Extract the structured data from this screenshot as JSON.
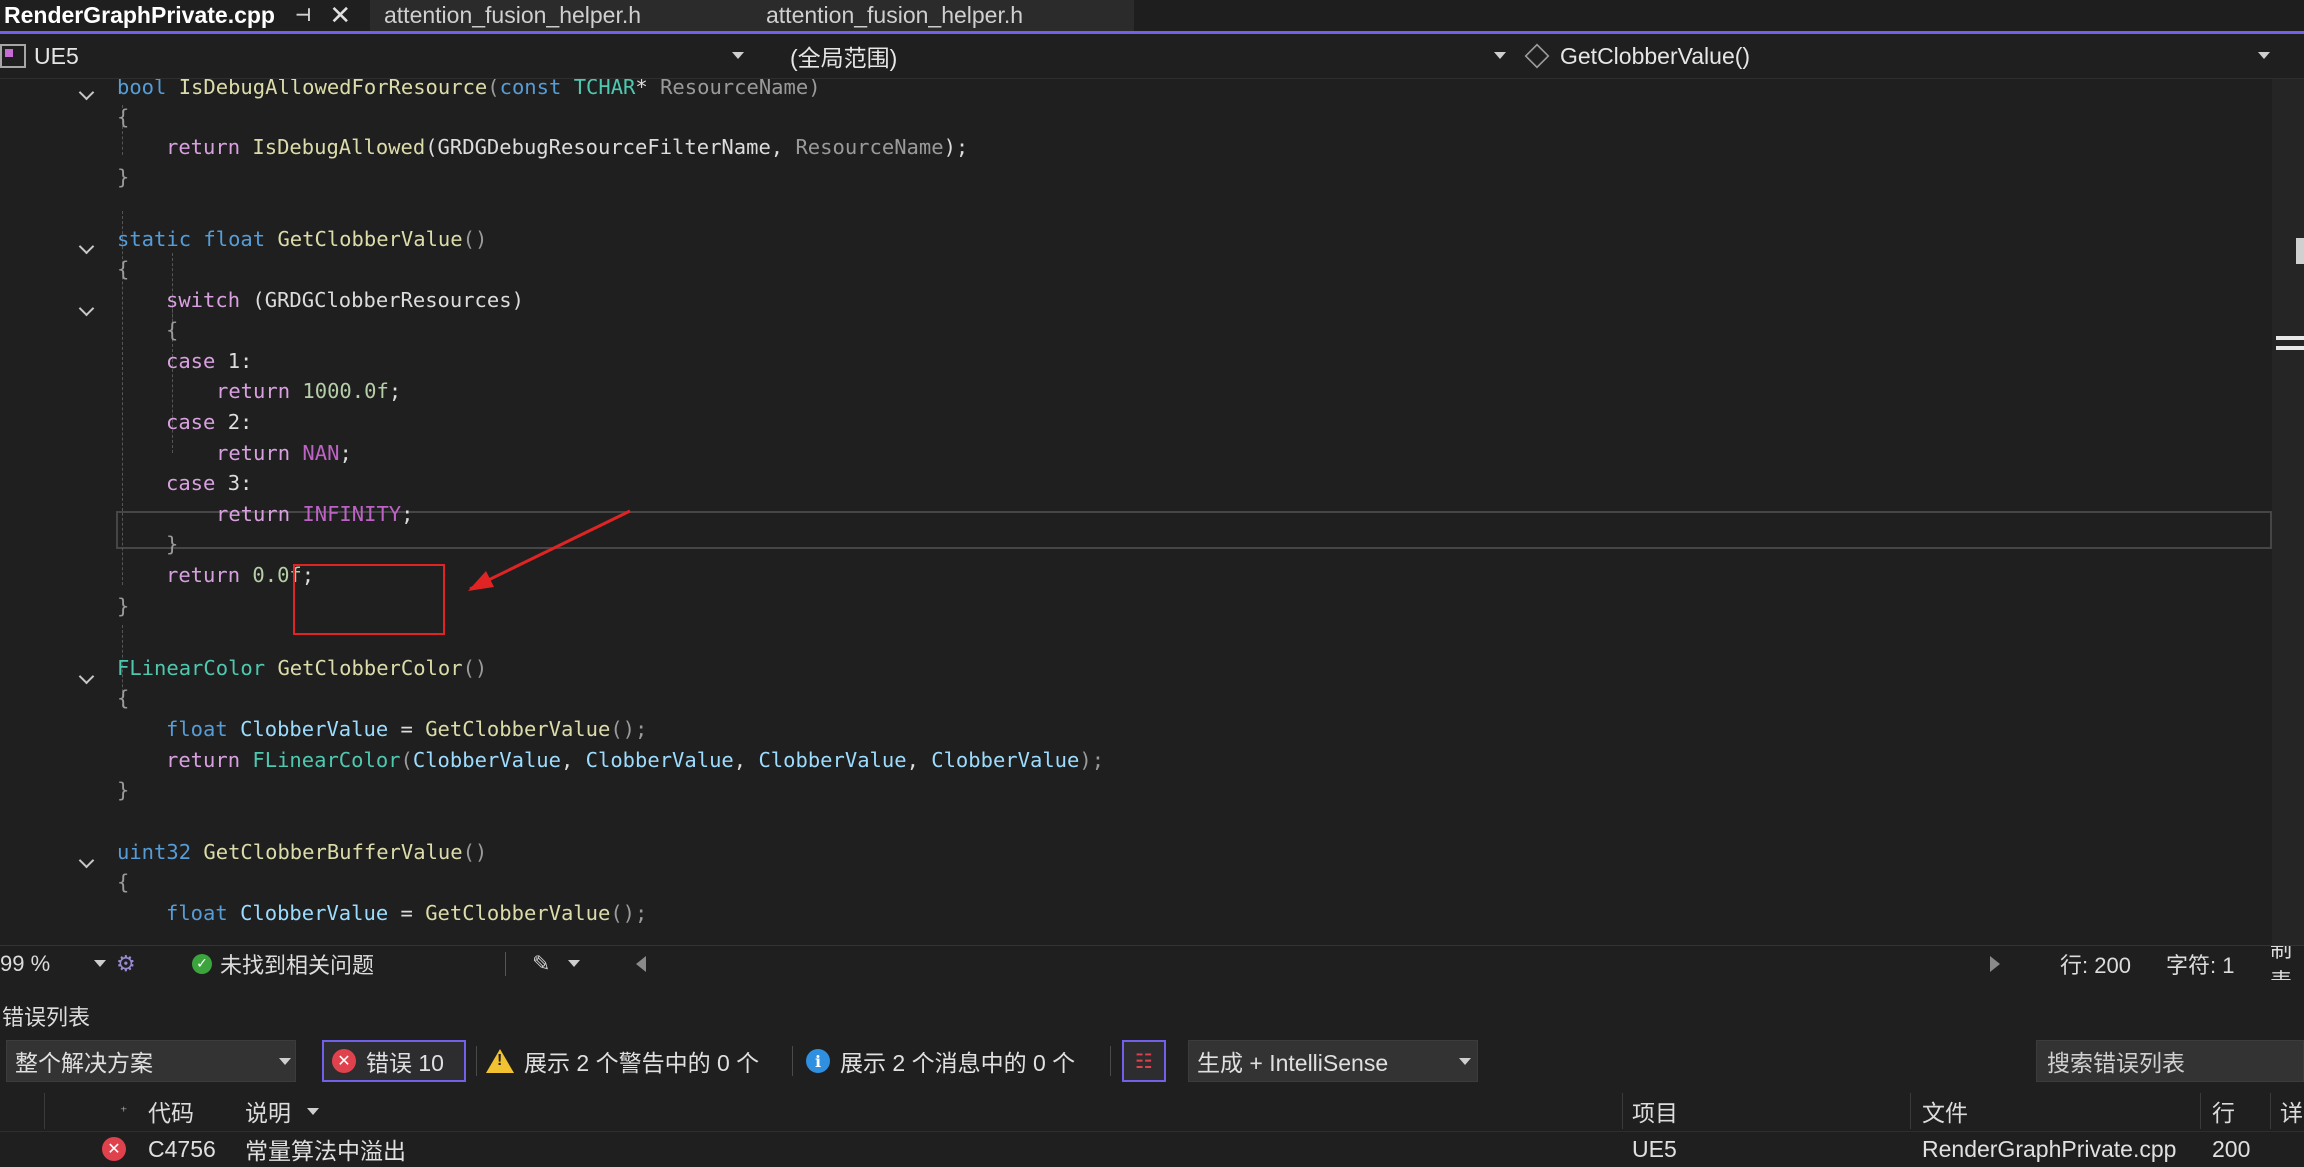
{
  "tabs": [
    {
      "label": "RenderGraphPrivate.cpp",
      "active": true
    },
    {
      "label": "attention_fusion_helper.h"
    },
    {
      "label": "attention_fusion_helper.h"
    }
  ],
  "tab_pin_icon": "pin-icon",
  "tab_close_icon": "close-icon",
  "navbar": {
    "project": "UE5",
    "scope": "(全局范围)",
    "member": "GetClobberValue()"
  },
  "code": {
    "l1": [
      "bool",
      "IsDebugAllowedForResource",
      "(",
      "const",
      "TCHAR",
      "*",
      "ResourceName",
      ")"
    ],
    "l2": "{",
    "l3": [
      "return",
      "IsDebugAllowed",
      "(GRDGDebugResourceFilterName, ",
      "ResourceName",
      ");"
    ],
    "l4": "}",
    "l6": [
      "static",
      "float",
      "GetClobberValue",
      "()"
    ],
    "l7": "{",
    "l8": [
      "switch",
      " (GRDGClobberResources)"
    ],
    "l9": "{",
    "l10": [
      "case",
      " 1:"
    ],
    "l11": [
      "return",
      "1000.0f",
      ";"
    ],
    "l12": [
      "case",
      " 2:"
    ],
    "l13": [
      "return",
      "NAN",
      ";"
    ],
    "l14": [
      "case",
      " 3:"
    ],
    "l15": [
      "return",
      "INFINITY",
      ";"
    ],
    "l16": "}",
    "l17": [
      "return",
      "0.0f",
      ";"
    ],
    "l18": "}",
    "l20": [
      "FLinearColor",
      "GetClobberColor",
      "()"
    ],
    "l21": "{",
    "l22": [
      "float",
      "ClobberValue",
      " = ",
      "GetClobberValue",
      "();"
    ],
    "l23": [
      "return",
      "FLinearColor",
      "(",
      "ClobberValue",
      ", ",
      "ClobberValue",
      ", ",
      "ClobberValue",
      ", ",
      "ClobberValue",
      ");"
    ],
    "l24": "}",
    "l26": [
      "uint32",
      "GetClobberBufferValue",
      "()"
    ],
    "l27": "{",
    "l28": [
      "float",
      "ClobberValue",
      " = ",
      "GetClobberValue",
      "();"
    ]
  },
  "statusbar": {
    "zoom": "99 %",
    "issues": "未找到相关问题",
    "line": "行: 200",
    "char": "字符: 1",
    "tab_mode": "制表"
  },
  "error_list": {
    "title": "错误列表",
    "scope": "整个解决方案",
    "errors": "错误 10",
    "warnings": "展示 2 个警告中的 0 个",
    "messages": "展示 2 个消息中的 0 个",
    "build_filter": "生成 + IntelliSense",
    "search_placeholder": "搜索错误列表",
    "columns": {
      "code": "代码",
      "description": "说明",
      "project": "项目",
      "file": "文件",
      "line": "行",
      "detail": "详"
    },
    "rows": [
      {
        "code": "C4756",
        "description": "常量算法中溢出",
        "project": "UE5",
        "file": "RenderGraphPrivate.cpp",
        "line": "200"
      }
    ]
  },
  "colors": {
    "accent": "#7160e8",
    "error": "#e0424d",
    "warning": "#f2c230",
    "info": "#2f8fe0",
    "annotation": "#e02424"
  }
}
